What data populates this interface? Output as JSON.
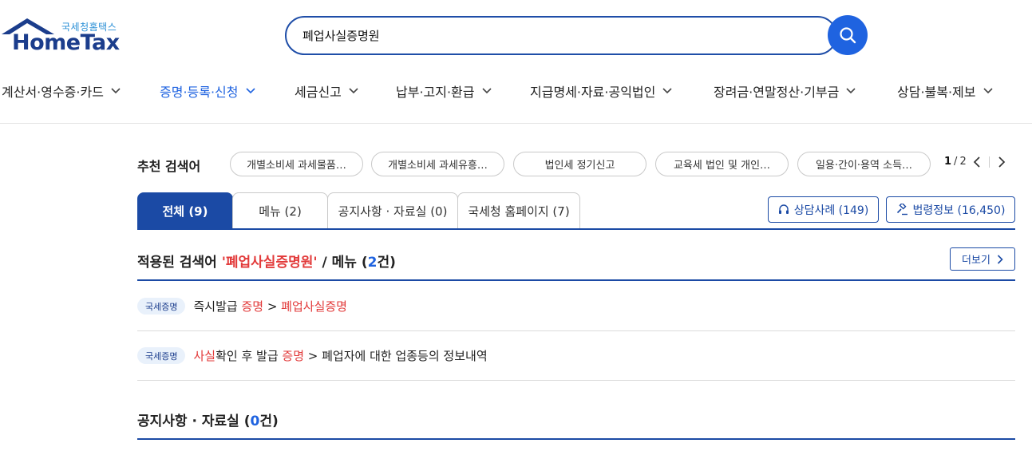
{
  "logo": {
    "sub": "국세청홈택스",
    "main": "HomeTax"
  },
  "search": {
    "value": "폐업사실증명원"
  },
  "gnb": [
    {
      "label": "계산서·영수증·카드"
    },
    {
      "label": "증명·등록·신청"
    },
    {
      "label": "세금신고"
    },
    {
      "label": "납부·고지·환급"
    },
    {
      "label": "지급명세·자료·공익법인"
    },
    {
      "label": "장려금·연말정산·기부금"
    },
    {
      "label": "상담·불복·제보"
    }
  ],
  "recommended": {
    "title": "추천 검색어",
    "chips": [
      "개별소비세 과세물품…",
      "개별소비세 과세유흥…",
      "법인세 정기신고",
      "교육세 법인 및 개인…",
      "일용·간이·용역 소득…"
    ],
    "page_current": "1",
    "page_sep": "/",
    "page_total": "2"
  },
  "tabs": [
    {
      "label": "전체 (9)"
    },
    {
      "label": "메뉴 (2)"
    },
    {
      "label": "공지사항 · 자료실 (0)"
    },
    {
      "label": "국세청 홈페이지 (7)"
    }
  ],
  "side_buttons": {
    "consult": "상담사례 (149)",
    "law": "법령정보 (16,450)"
  },
  "menu_section": {
    "prefix": "적용된 검색어 ",
    "keyword": "'폐업사실증명원'",
    "middle": " / 메뉴 (",
    "count": "2",
    "suffix": "건)",
    "more": "더보기"
  },
  "results": [
    {
      "badge": "국세증명",
      "parts": [
        {
          "text": "즉시발급 ",
          "hl": false
        },
        {
          "text": "증명",
          "hl": true
        },
        {
          "text": " > ",
          "hl": false
        },
        {
          "text": "폐업사실증명",
          "hl": true
        }
      ]
    },
    {
      "badge": "국세증명",
      "parts": [
        {
          "text": "사실",
          "hl": true
        },
        {
          "text": "확인 후 발급 ",
          "hl": false
        },
        {
          "text": "증명",
          "hl": true
        },
        {
          "text": " > 폐업자에 대한 업종등의 정보내역",
          "hl": false
        }
      ]
    }
  ],
  "notice_section": {
    "prefix": "공지사항 · 자료실 (",
    "count": "0",
    "suffix": "건)"
  },
  "colors": {
    "brand_navy": "#1b4aa5",
    "accent_blue": "#1f63e0",
    "highlight_red": "#e23a3a"
  }
}
